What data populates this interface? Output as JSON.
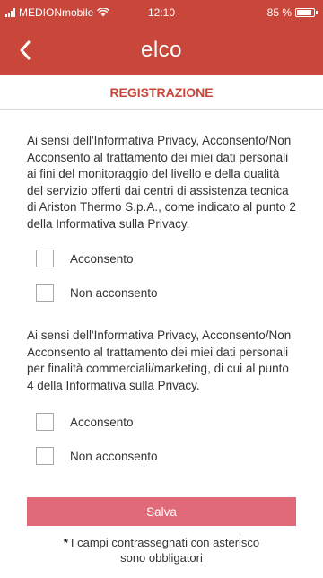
{
  "status_bar": {
    "carrier": "MEDIONmobile",
    "time": "12:10",
    "battery": "85 %"
  },
  "header": {
    "logo_text": "elco",
    "back_icon": "chevron-left-icon",
    "bg_color": "#c9463a"
  },
  "page_title": "REGISTRAZIONE",
  "section1": {
    "text": "Ai sensi dell'Informativa Privacy, Acconsento/Non Acconsento al trattamento dei miei dati personali ai fini del monitoraggio del livello e della qualità del servizio offerti dai centri di assistenza tecnica di Ariston Thermo S.p.A., come indicato al punto 2 della Informativa sulla Privacy.",
    "options": [
      "Acconsento",
      "Non acconsento"
    ]
  },
  "section2": {
    "text": "Ai sensi dell'Informativa Privacy, Acconsento/Non Acconsento al trattamento dei miei dati personali per finalità  commerciali/marketing, di cui al punto 4 della Informativa sulla Privacy.",
    "options": [
      "Acconsento",
      "Non acconsento"
    ]
  },
  "save_button": {
    "label": "Salva",
    "color": "#e06a78"
  },
  "footnote": {
    "asterisk": "*",
    "line1": "I campi contrassegnati con asterisco",
    "line2": "sono obbligatori"
  }
}
